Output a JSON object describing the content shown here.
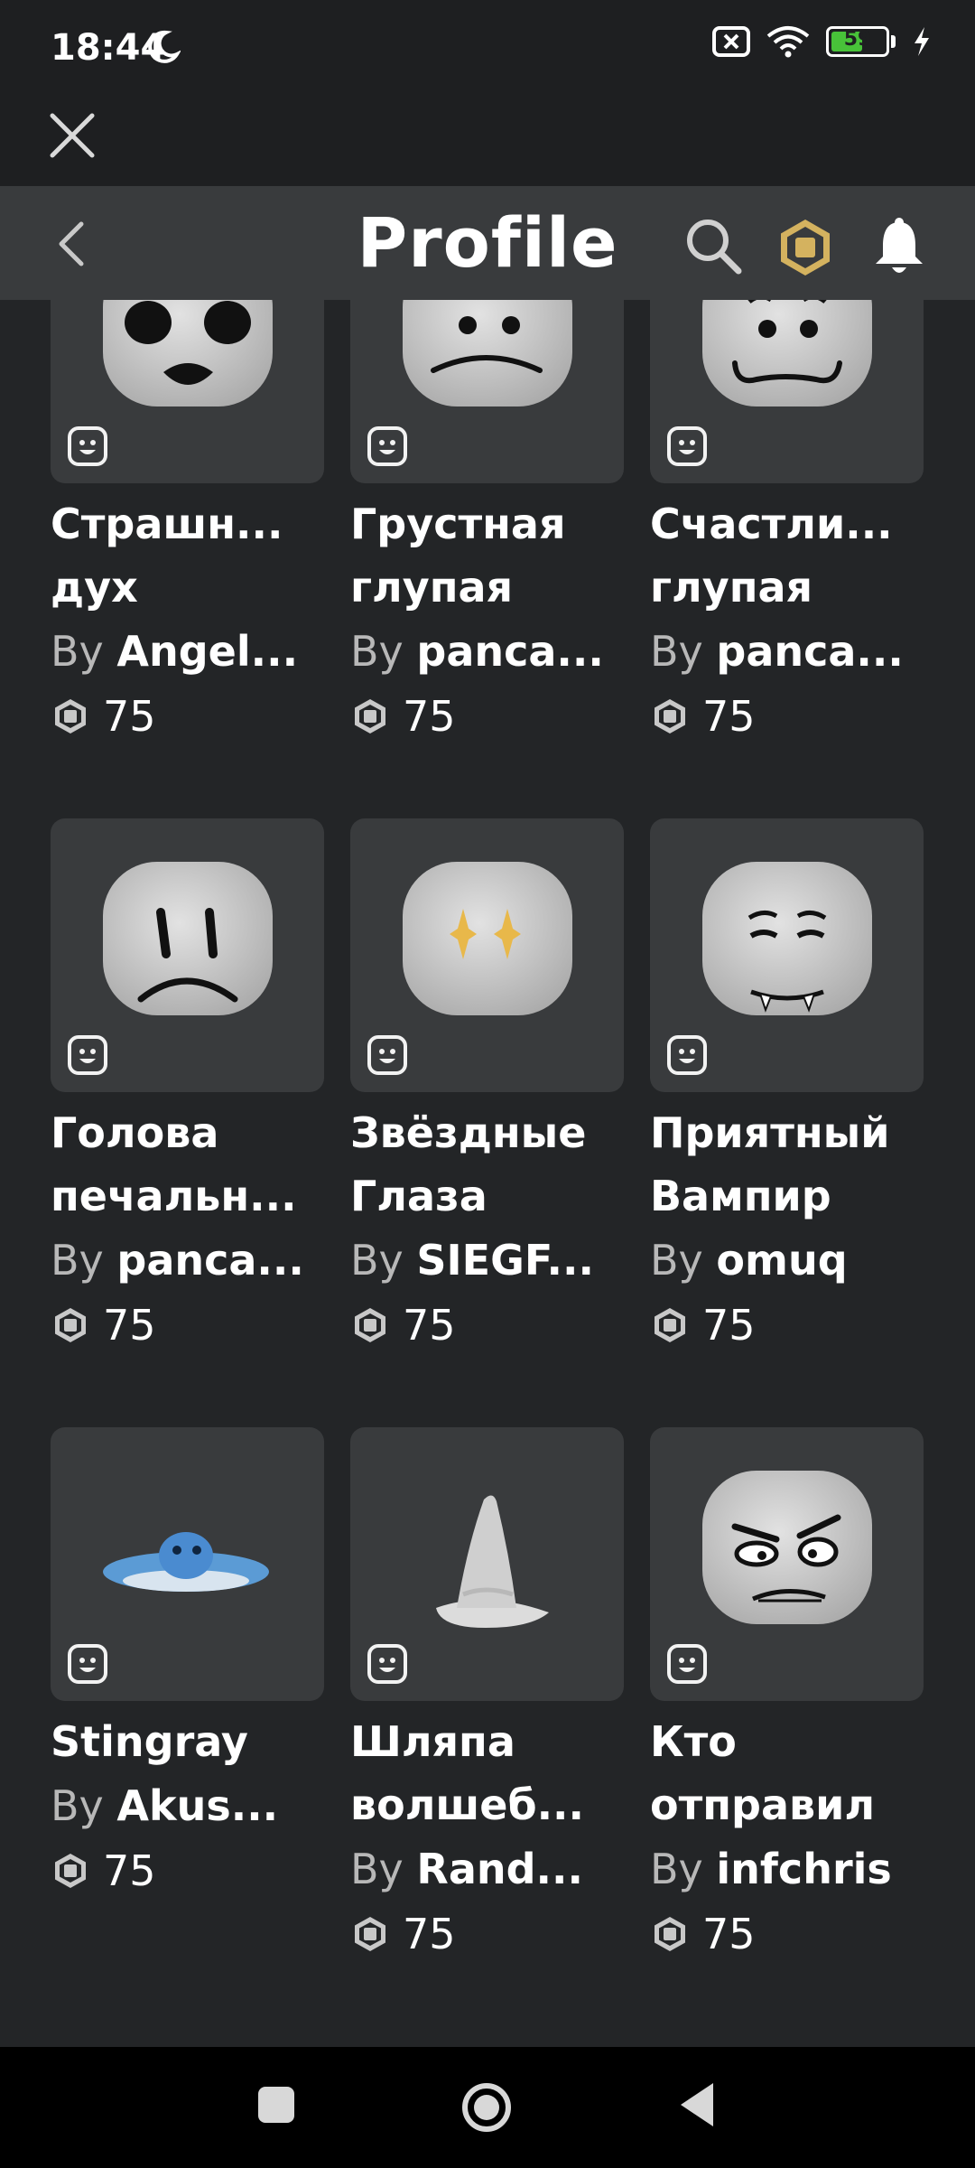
{
  "status_bar": {
    "time": "18:44",
    "battery_level": "59",
    "battery_fraction": 0.59
  },
  "header": {
    "title": "Profile"
  },
  "colors": {
    "background": "#232527",
    "header": "#393b3d",
    "tile": "#393b3d",
    "robux_gold": "#d4b25f",
    "battery_green": "#48c239"
  },
  "items": [
    {
      "name": "Страшн...",
      "name2": "дух",
      "by": "By",
      "creator": "Angel...",
      "price": "75",
      "art": "ghost"
    },
    {
      "name": "Грустная",
      "name2": "глупая",
      "by": "By",
      "creator": "panca...",
      "price": "75",
      "art": "sad-silly"
    },
    {
      "name": "Счастли...",
      "name2": "глупая",
      "by": "By",
      "creator": "panca...",
      "price": "75",
      "art": "happy-silly"
    },
    {
      "name": "Голова",
      "name2": "печальн...",
      "by": "By",
      "creator": "panca...",
      "price": "75",
      "art": "sad-head"
    },
    {
      "name": "Звёздные",
      "name2": "Глаза",
      "by": "By",
      "creator": "SIEGF...",
      "price": "75",
      "art": "star-eyes"
    },
    {
      "name": "Приятный",
      "name2": "Вампир",
      "by": "By",
      "creator": "omuq",
      "price": "75",
      "art": "vampire"
    },
    {
      "name": "Stingray",
      "name2": "",
      "by": "By",
      "creator": "Akus...",
      "price": "75",
      "art": "stingray"
    },
    {
      "name": "Шляпа",
      "name2": "волшеб...",
      "by": "By",
      "creator": "Rand...",
      "price": "75",
      "art": "wizard-hat"
    },
    {
      "name": "Кто",
      "name2": "отправил",
      "by": "By",
      "creator": "infchris",
      "price": "75",
      "art": "annoyed"
    }
  ]
}
